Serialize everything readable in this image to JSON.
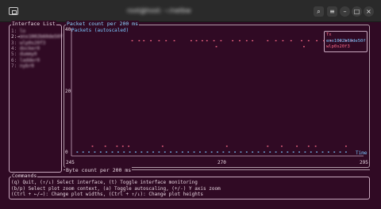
{
  "window": {
    "title": "root@host: ~/netbw",
    "buttons": {
      "search": "⌕",
      "menu": "≡",
      "minimize": "–",
      "maximize": "□",
      "close": "×"
    }
  },
  "interface_panel": {
    "title": "Interface List",
    "items": [
      {
        "num": "1:",
        "name": "lo"
      },
      {
        "num": "2:",
        "name": "enx1002b60de50f",
        "selected": true,
        "marker": "→"
      },
      {
        "num": "3:",
        "name": "wlp0s20f3"
      },
      {
        "num": "4:",
        "name": "docker0"
      },
      {
        "num": "5:",
        "name": "dummy0"
      },
      {
        "num": "6:",
        "name": "ladder0"
      },
      {
        "num": "7:",
        "name": "nybr0"
      }
    ]
  },
  "packet_plot": {
    "title": "Packet count per 200 ms",
    "series_label": "Packets (autoscaled)",
    "time_axis_label": "Time",
    "legend": [
      {
        "label": "Tx",
        "color": "#ff6b8a"
      },
      {
        "label": "enx1002b60de50f",
        "color": "#7ac6ff"
      },
      {
        "label": "wlp0s20f3",
        "color": "#ff6b8a"
      }
    ]
  },
  "byte_plot": {
    "title": "Byte count per 200 ms"
  },
  "commands": {
    "title": "Commands",
    "lines": [
      "(q) Quit, (↑/↓) Select interface, (t) Toggle interface monitoring",
      "(b/p) Select plot zoom context, (a) Toggle autoscaling, (+/-) Y axis zoom",
      "(Ctrl + ←/→): Change plot widths, (Ctrl + ↑/↓): Change plot heights"
    ]
  },
  "colors": {
    "tx": "#ff6b8a",
    "rx": "#7ac6ff",
    "background": "#300a24"
  },
  "chart_data": {
    "type": "scatter",
    "title": "Packet count per 200 ms",
    "xlabel": "Time",
    "ylabel": "Packets (autoscaled)",
    "xlim": [
      245,
      295
    ],
    "ylim": [
      0,
      40
    ],
    "x_ticks": [
      "245",
      "270",
      "295"
    ],
    "y_ticks": [
      "0",
      "20",
      "40"
    ],
    "series": [
      {
        "name": "Tx",
        "points": [
          [
            255.4,
            38
          ],
          [
            256.6,
            38
          ],
          [
            257.4,
            38
          ],
          [
            258.6,
            38
          ],
          [
            260.0,
            38
          ],
          [
            261.2,
            38
          ],
          [
            262.6,
            38
          ],
          [
            265.5,
            38
          ],
          [
            266.4,
            38
          ],
          [
            267.4,
            38
          ],
          [
            268.2,
            38
          ],
          [
            269.4,
            38
          ],
          [
            270.6,
            38
          ],
          [
            272.6,
            38
          ],
          [
            273.8,
            38
          ],
          [
            275.0,
            38
          ],
          [
            276.0,
            38
          ],
          [
            278.6,
            38
          ],
          [
            280.0,
            38
          ],
          [
            281.2,
            38
          ],
          [
            282.6,
            38
          ],
          [
            284.4,
            38
          ],
          [
            285.6,
            38
          ],
          [
            287.0,
            38
          ],
          [
            288.2,
            38
          ],
          [
            289.4,
            38
          ],
          [
            291.0,
            38
          ],
          [
            292.0,
            38
          ],
          [
            293.0,
            38
          ],
          [
            269.8,
            36
          ],
          [
            284.8,
            36
          ],
          [
            248.6,
            2
          ],
          [
            250.8,
            2
          ],
          [
            252.8,
            2
          ],
          [
            253.8,
            2
          ],
          [
            254.8,
            2
          ],
          [
            260.6,
            2
          ],
          [
            271.6,
            2
          ],
          [
            278.6,
            2
          ],
          [
            281.0,
            2
          ],
          [
            283.6,
            2
          ],
          [
            285.6,
            2
          ],
          [
            286.8,
            2
          ],
          [
            292.0,
            2
          ]
        ]
      },
      {
        "name": "enx1002b60de50f",
        "points": [
          [
            246.0,
            0
          ],
          [
            247.0,
            0
          ],
          [
            248.0,
            0
          ],
          [
            249.0,
            0
          ],
          [
            250.0,
            0
          ],
          [
            251.0,
            0
          ],
          [
            252.0,
            0
          ],
          [
            253.0,
            0
          ],
          [
            254.0,
            0
          ],
          [
            255.0,
            0
          ],
          [
            256.0,
            0
          ],
          [
            257.0,
            0
          ],
          [
            258.0,
            0
          ],
          [
            259.0,
            0
          ],
          [
            260.0,
            0
          ],
          [
            261.0,
            0
          ],
          [
            262.0,
            0
          ],
          [
            263.0,
            0
          ],
          [
            264.0,
            0
          ],
          [
            265.0,
            0
          ],
          [
            266.0,
            0
          ],
          [
            267.0,
            0
          ],
          [
            268.0,
            0
          ],
          [
            269.0,
            0
          ],
          [
            270.0,
            0
          ],
          [
            271.0,
            0
          ],
          [
            272.0,
            0
          ],
          [
            273.0,
            0
          ],
          [
            274.0,
            0
          ],
          [
            275.0,
            0
          ],
          [
            276.0,
            0
          ],
          [
            277.0,
            0
          ],
          [
            278.0,
            0
          ],
          [
            279.0,
            0
          ],
          [
            280.0,
            0
          ],
          [
            281.0,
            0
          ],
          [
            282.0,
            0
          ],
          [
            283.0,
            0
          ],
          [
            284.0,
            0
          ],
          [
            285.0,
            0
          ],
          [
            286.0,
            0
          ],
          [
            287.0,
            0
          ],
          [
            288.0,
            0
          ],
          [
            289.0,
            0
          ],
          [
            290.0,
            0
          ],
          [
            291.0,
            0
          ],
          [
            292.0,
            0
          ]
        ]
      }
    ]
  }
}
